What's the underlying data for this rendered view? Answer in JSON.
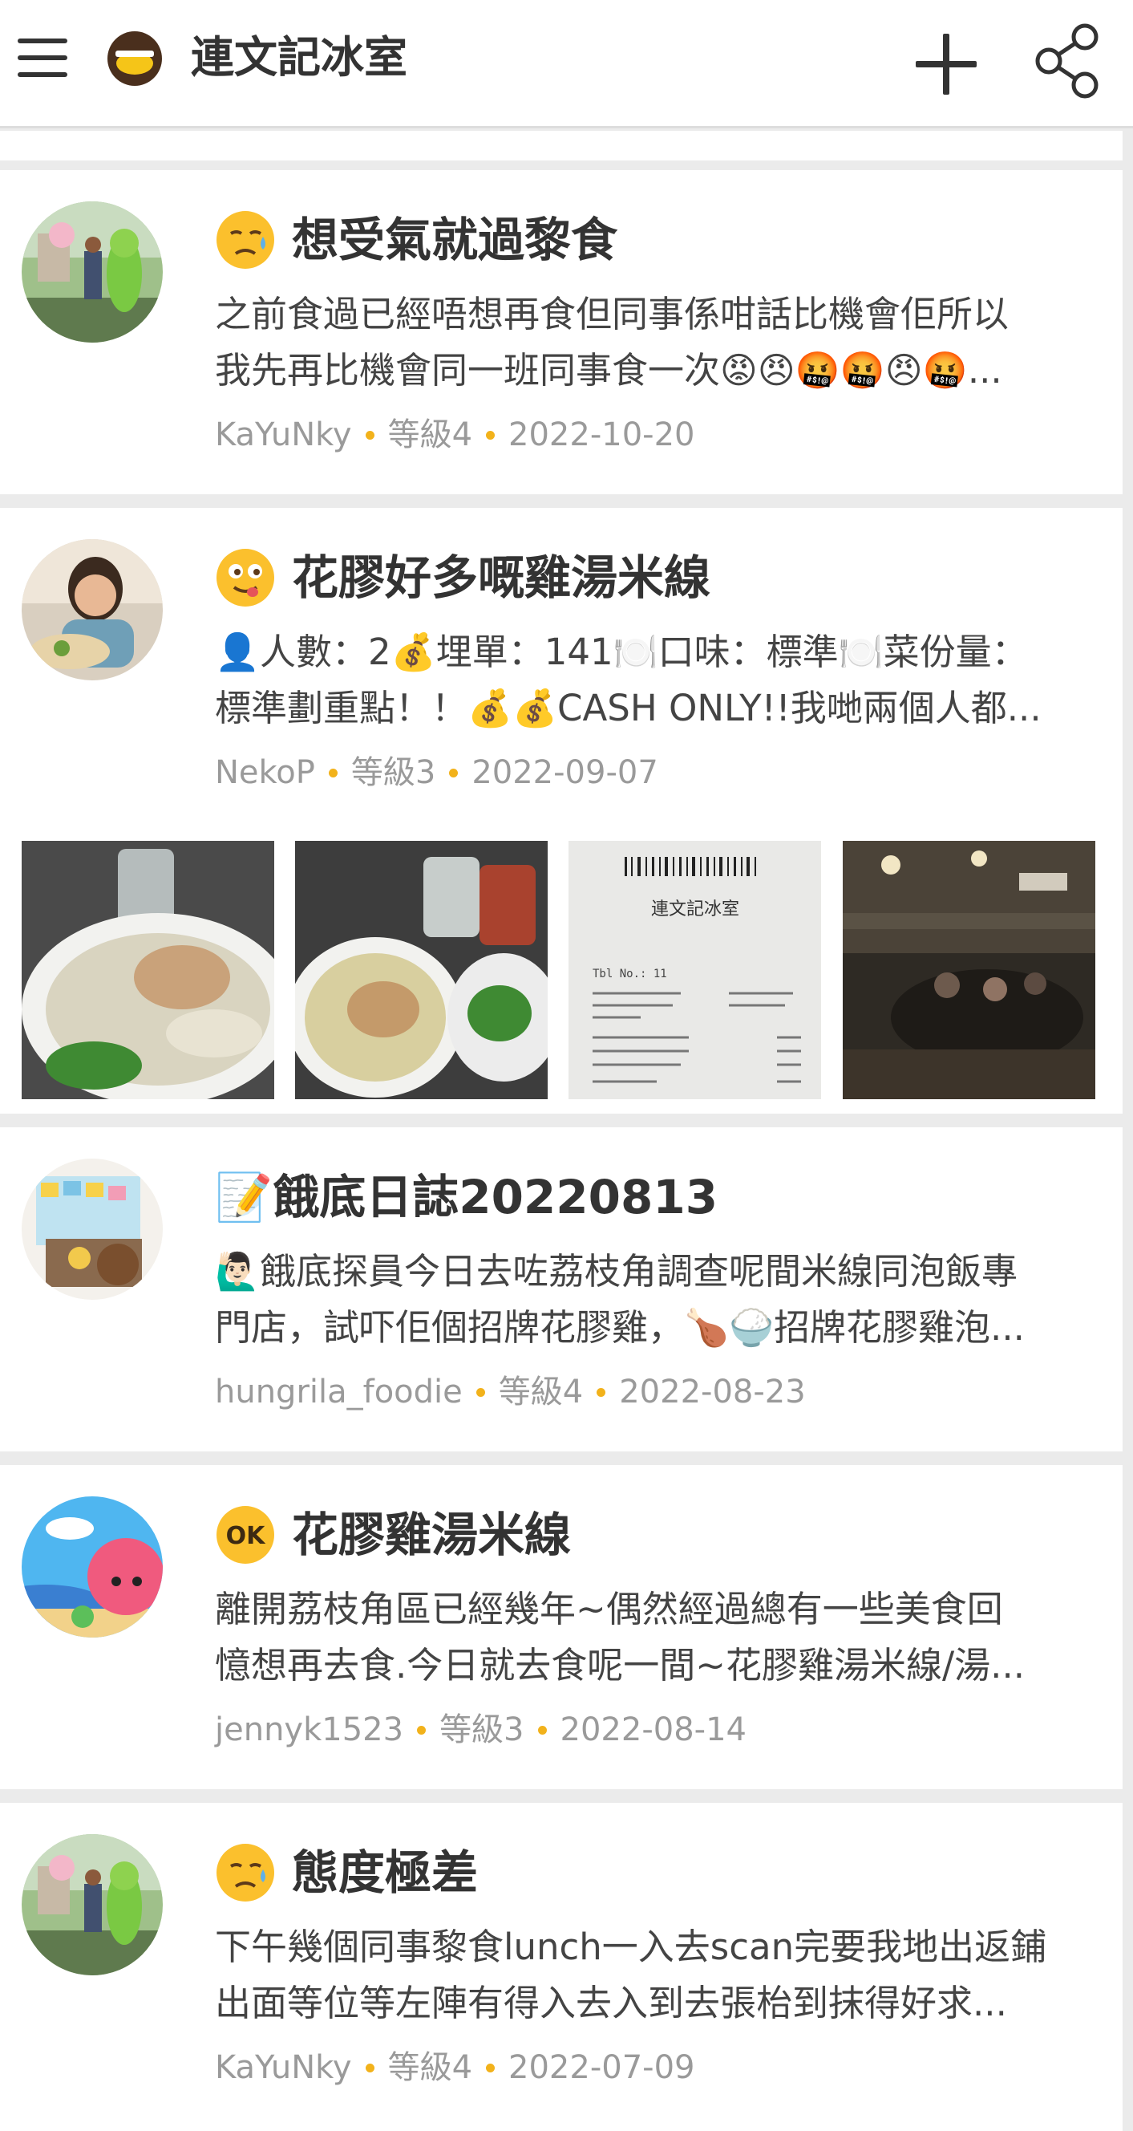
{
  "header": {
    "title": "連文記冰室",
    "menu_icon": "hamburger-menu-icon",
    "logo_icon": "restaurant-logo-icon",
    "add_icon": "plus-icon",
    "share_icon": "share-icon"
  },
  "reviews": [
    {
      "mood_icon": "sad-face-icon",
      "title": "想受氣就過黎食",
      "body_line1": "之前食過已經唔想再食但同事係咁話比機會佢所以",
      "body_line2": "我先再比機會同一班同事食一次😡😠🤬🤬😠🤬...",
      "user": "KaYuNky",
      "level": "等級4",
      "date": "2022-10-20"
    },
    {
      "mood_icon": "yummy-face-icon",
      "title": "花膠好多嘅雞湯米線",
      "body_line1": "👤人數：2💰埋單：141🍽️口味：標準🍽️菜份量：",
      "body_line2": "標準劃重點！！💰💰CASH ONLY!!我哋兩個人都...",
      "user": "NekoP",
      "level": "等級3",
      "date": "2022-09-07",
      "photos": [
        "soup-noodle-photo",
        "chicken-soup-noodle-photo",
        "receipt-photo",
        "restaurant-interior-photo"
      ]
    },
    {
      "mood_icon": "memo-icon",
      "title": "📝餓底日誌20220813",
      "body_line1": "🙋🏻‍♂️餓底探員今日去咗荔枝角調查呢間米線同泡飯專",
      "body_line2": "門店，試吓佢個招牌花膠雞，🍗🍚招牌花膠雞泡...",
      "user": "hungrila_foodie",
      "level": "等級4",
      "date": "2022-08-23"
    },
    {
      "mood_icon": "ok-badge-icon",
      "mood_text": "OK",
      "title": "花膠雞湯米線",
      "body_line1": "離開荔枝角區已經幾年~偶然經過總有一些美食回",
      "body_line2": "憶想再去食.今日就去食呢一間~花膠雞湯米線/湯...",
      "user": "jennyk1523",
      "level": "等級3",
      "date": "2022-08-14"
    },
    {
      "mood_icon": "sad-face-icon",
      "title": "態度極差",
      "body_line1": "下午幾個同事黎食lunch一入去scan完要我地出返鋪",
      "body_line2": "出面等位等左陣有得入去入到去張枱到抹得好求...",
      "user": "KaYuNky",
      "level": "等級4",
      "date": "2022-07-09"
    }
  ],
  "receipt": {
    "shop": "連文記冰室",
    "table": "Tbl No.: 11"
  }
}
